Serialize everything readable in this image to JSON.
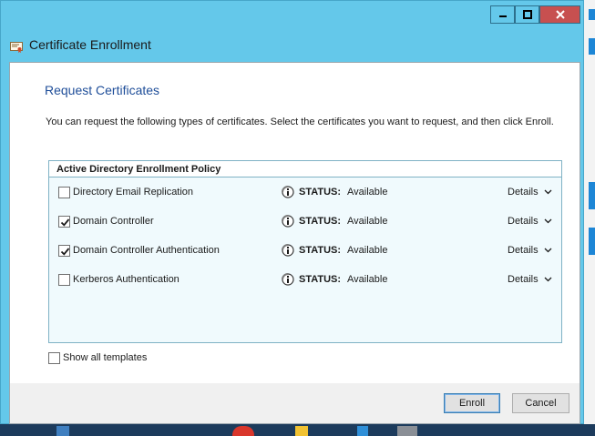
{
  "window": {
    "title": "Certificate Enrollment",
    "controls": {
      "minimize": "minimize",
      "maximize": "maximize",
      "close": "close"
    }
  },
  "page": {
    "heading": "Request Certificates",
    "description": "You can request the following types of certificates. Select the certificates you want to request, and then click Enroll."
  },
  "policy": {
    "title": "Active Directory Enrollment Policy",
    "status_key": "STATUS:",
    "details_label": "Details",
    "items": [
      {
        "label": "Directory Email Replication",
        "checked": false,
        "status": "Available"
      },
      {
        "label": "Domain Controller",
        "checked": true,
        "status": "Available"
      },
      {
        "label": "Domain Controller Authentication",
        "checked": true,
        "status": "Available"
      },
      {
        "label": "Kerberos Authentication",
        "checked": false,
        "status": "Available"
      }
    ]
  },
  "show_all": {
    "label": "Show all templates",
    "checked": false
  },
  "buttons": {
    "enroll": "Enroll",
    "cancel": "Cancel"
  },
  "colors": {
    "titlebar": "#64c8ea",
    "heading": "#1f4e99",
    "close": "#c75050"
  }
}
